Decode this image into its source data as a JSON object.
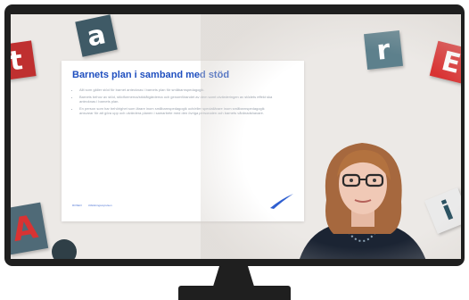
{
  "tiles": [
    {
      "letter": "a",
      "bg": "#3f5a66",
      "color": "#ffffff"
    },
    {
      "letter": "t",
      "bg": "#bf3030",
      "color": "#ffffff"
    },
    {
      "letter": "r",
      "bg": "#5d808c",
      "color": "#ffffff"
    },
    {
      "letter": "E",
      "bg": "#d93333",
      "color": "#ffffff"
    },
    {
      "letter": "A",
      "bg": "#4f6a77",
      "color": "#d93333"
    },
    {
      "letter": "i",
      "bg": "#eaeaea",
      "color": "#2b5261"
    }
  ],
  "slide": {
    "title": "Barnets plan i samband med stöd",
    "bullets": [
      "Allt som gäller stöd för barnet antecknas i barnets plan för småbarnspedagogik.",
      "Barnets behov av stöd, stödformerna/stödåtgärderna och genomförandet av dem samt utvärderingen av stödets effekt ska antecknas i barnets plan.",
      "En person som har behörighet som lärare inom småbarnspedagogik och/eller speciallärare inom småbarnspedagogik ansvarar för att göra upp och utvärdera planen i samarbete med den övriga personalen och barnets vårdnadshavare."
    ],
    "footer": [
      "ROSEO",
      "Utbildningsstyrelsen"
    ]
  },
  "colors": {
    "title_blue": "#1f4fbf",
    "monitor": "#1f1f1f",
    "background": "#ece9e6"
  }
}
